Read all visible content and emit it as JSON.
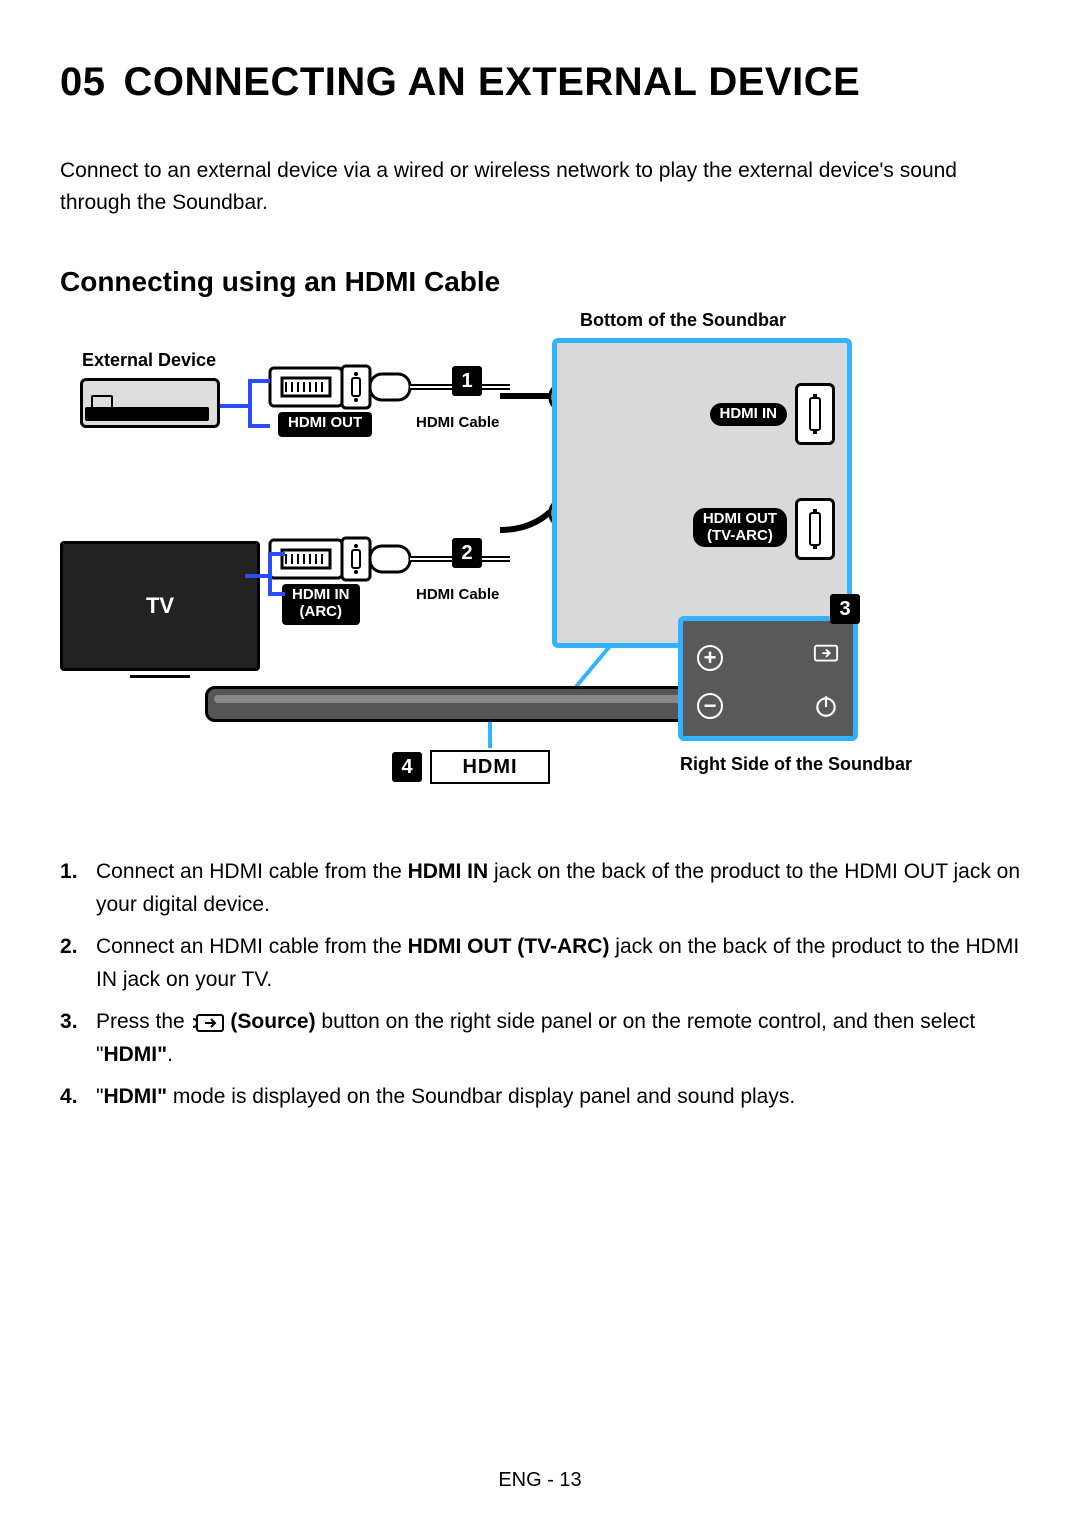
{
  "chapter": {
    "number": "05",
    "title": "CONNECTING AN EXTERNAL DEVICE"
  },
  "intro": "Connect to an external device via a wired or wireless network to play the external device's sound through the Soundbar.",
  "section_title": "Connecting using an HDMI Cable",
  "diagram": {
    "bottom_label": "Bottom of the Soundbar",
    "right_label": "Right Side of the Soundbar",
    "external_device": "External Device",
    "tv": "TV",
    "hdmi_cable": "HDMI Cable",
    "hdmi_out": "HDMI OUT",
    "hdmi_in_arc": "HDMI IN\n(ARC)",
    "port_in": "HDMI IN",
    "port_out": "HDMI OUT\n(TV-ARC)",
    "hdmi_display": "HDMI",
    "markers": {
      "one": "1",
      "two": "2",
      "three": "3",
      "four": "4"
    }
  },
  "steps": {
    "s1a": "Connect an HDMI cable from the ",
    "s1b": "HDMI IN",
    "s1c": " jack on the back of the product to the HDMI OUT jack on your digital device.",
    "s2a": "Connect an HDMI cable from the ",
    "s2b": "HDMI OUT (TV-ARC)",
    "s2c": " jack on the back of the product to the HDMI IN jack on your TV.",
    "s3a": "Press the ",
    "s3b": " (Source)",
    "s3c": " button on the right side panel or on the remote control, and then select \"",
    "s3d": "HDMI\"",
    "s3e": ".",
    "s4a": "\"",
    "s4b": "HDMI\"",
    "s4c": " mode is displayed on the Soundbar display panel and sound plays."
  },
  "footer": "ENG - 13"
}
